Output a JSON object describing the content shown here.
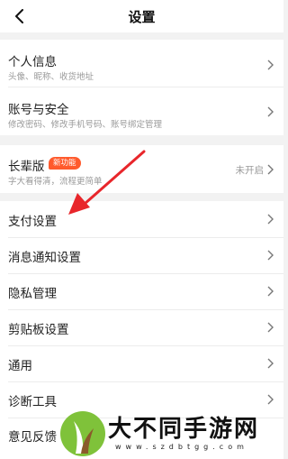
{
  "header": {
    "title": "设置",
    "back_icon": "chevron-left-icon"
  },
  "groups": [
    {
      "items": [
        {
          "label": "个人信息",
          "sub": "头像、昵称、收货地址"
        },
        {
          "label": "账号与安全",
          "sub": "修改密码、修改手机号码、账号绑定管理"
        }
      ]
    },
    {
      "items": [
        {
          "label": "长辈版",
          "sub": "字大看得清，流程更简单",
          "badge": "新功能",
          "status": "未开启"
        }
      ]
    },
    {
      "items": [
        {
          "label": "支付设置"
        },
        {
          "label": "消息通知设置"
        },
        {
          "label": "隐私管理"
        },
        {
          "label": "剪贴板设置"
        },
        {
          "label": "通用"
        },
        {
          "label": "诊断工具"
        },
        {
          "label": "意见反馈"
        }
      ]
    }
  ],
  "annotation": {
    "arrow_color": "#e8262b"
  },
  "watermark": {
    "text": "大不同手游网",
    "url": "www.szdbtgg.com"
  },
  "colors": {
    "background": "#f2f2f2",
    "badge": "#ff5a2c",
    "secondary_text": "#9a9a9a"
  }
}
